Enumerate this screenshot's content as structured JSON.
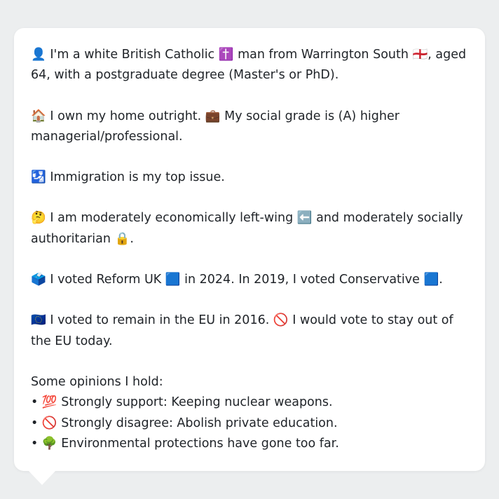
{
  "profile": {
    "identity": "👤 I'm a white British Catholic ✝️ man from Warrington South 🏴󠁧󠁢󠁥󠁮󠁧󠁿, aged 64, with a postgraduate degree (Master's or PhD).",
    "home_grade": "🏠 I own my home outright. 💼 My social grade is (A) higher managerial/professional.",
    "top_issue": "🛂 Immigration is my top issue.",
    "ideology": "🤔 I am moderately economically left-wing ⬅️ and moderately socially authoritarian 🔒.",
    "votes": "🗳️ I voted Reform UK 🟦 in 2024. In 2019, I voted Conservative 🟦.",
    "eu": "🇪🇺 I voted to remain in the EU in 2016. 🚫 I would vote to stay out of the EU today."
  },
  "opinions": {
    "heading": "Some opinions I hold:",
    "items": [
      "• 💯 Strongly support: Keeping nuclear weapons.",
      "• 🚫 Strongly disagree: Abolish private education.",
      "• 🌳 Environmental protections have gone too far."
    ]
  }
}
